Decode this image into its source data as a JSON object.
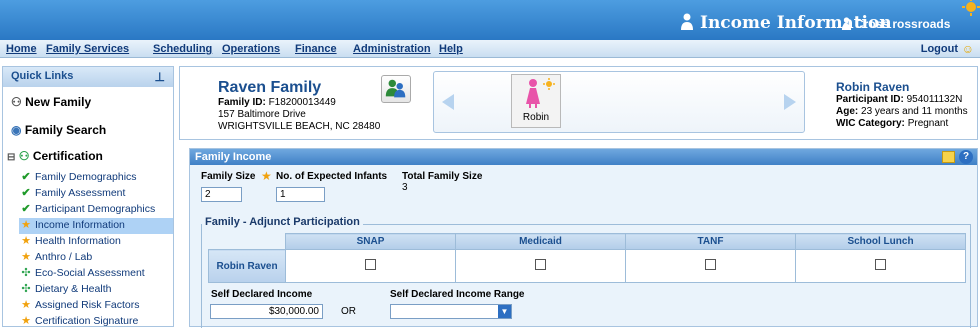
{
  "app": {
    "title": "Income Information",
    "user": "Cross rossroads"
  },
  "menu": {
    "items": [
      "Home",
      "Family Services",
      "Scheduling",
      "Operations",
      "Finance",
      "Administration",
      "Help"
    ],
    "logout": "Logout"
  },
  "sidebar": {
    "header": "Quick Links",
    "new_family": "New Family",
    "family_search": "Family Search",
    "certification": "Certification",
    "items": [
      {
        "label": "Family Demographics",
        "icon": "check-icon"
      },
      {
        "label": "Family Assessment",
        "icon": "check-icon"
      },
      {
        "label": "Participant Demographics",
        "icon": "check-icon"
      },
      {
        "label": "Income Information",
        "icon": "star-icon",
        "selected": true
      },
      {
        "label": "Health Information",
        "icon": "star-icon"
      },
      {
        "label": "Anthro / Lab",
        "icon": "star-icon"
      },
      {
        "label": "Eco-Social Assessment",
        "icon": "eco-icon"
      },
      {
        "label": "Dietary & Health",
        "icon": "eco-icon"
      },
      {
        "label": "Assigned Risk Factors",
        "icon": "star-icon"
      },
      {
        "label": "Certification Signature",
        "icon": "star-icon"
      }
    ]
  },
  "family": {
    "name": "Raven Family",
    "id_label": "Family ID:",
    "id": "F18200013449",
    "address1": "157 Baltimore Drive",
    "address2": "WRIGHTSVILLE BEACH,   NC  28480"
  },
  "carousel": {
    "member": "Robin"
  },
  "participant": {
    "name": "Robin Raven",
    "id_label": "Participant ID:",
    "id": "954011132N",
    "age_label": "Age:",
    "age": "23 years and 11 months",
    "wic_label": "WIC Category:",
    "wic": "Pregnant"
  },
  "income": {
    "panel_title": "Family Income",
    "family_size_label": "Family Size",
    "family_size": "2",
    "expected_infants_label": "No. of Expected Infants",
    "expected_infants": "1",
    "total_family_size_label": "Total Family Size",
    "total_family_size": "3",
    "adjunct_legend": "Family - Adjunct Participation",
    "adjunct_columns": [
      "SNAP",
      "Medicaid",
      "TANF",
      "School Lunch"
    ],
    "adjunct_row": "Robin Raven",
    "self_declared_label": "Self Declared Income",
    "self_declared_value": "$30,000.00",
    "or_label": "OR",
    "range_label": "Self Declared Income Range"
  },
  "colors": {
    "accent": "#2a78c4",
    "link": "#103a7a"
  }
}
